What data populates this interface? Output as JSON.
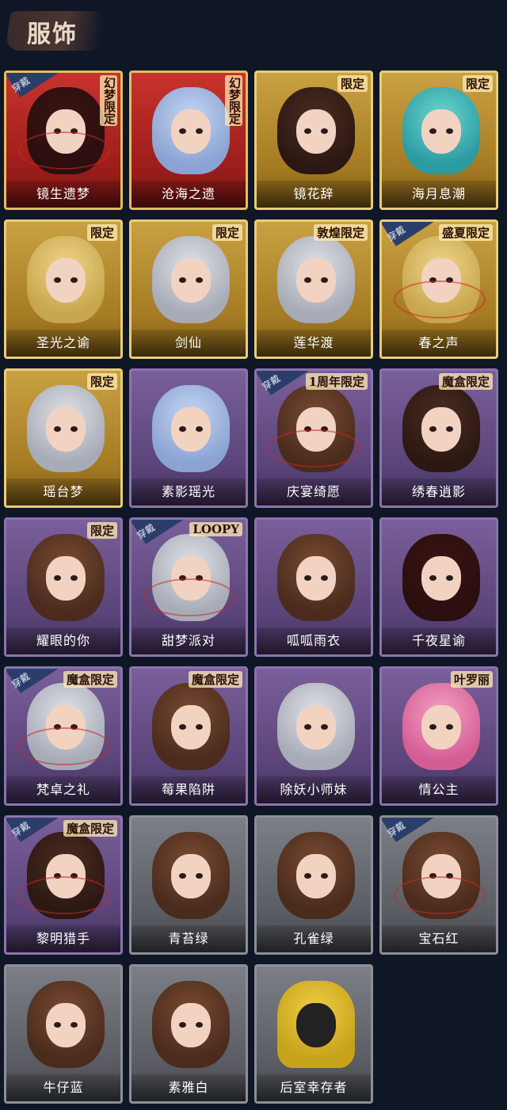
{
  "header": {
    "title": "服饰"
  },
  "colors": {
    "background": "#0f1726"
  },
  "cards": [
    {
      "name": "镜生遗梦",
      "rarity": "red",
      "tag": "幻梦限定",
      "tag_vertical": true,
      "wearing": true,
      "wear_label": "穿戴",
      "hair": "red"
    },
    {
      "name": "沧海之遗",
      "rarity": "red",
      "tag": "幻梦限定",
      "tag_vertical": true,
      "wearing": false,
      "wear_label": "",
      "hair": "blue"
    },
    {
      "name": "镜花辞",
      "rarity": "gold",
      "tag": "限定",
      "tag_vertical": false,
      "wearing": false,
      "wear_label": "",
      "hair": "dark"
    },
    {
      "name": "海月息潮",
      "rarity": "gold",
      "tag": "限定",
      "tag_vertical": false,
      "wearing": false,
      "wear_label": "",
      "hair": "teal"
    },
    {
      "name": "圣光之谕",
      "rarity": "gold",
      "tag": "限定",
      "tag_vertical": false,
      "wearing": false,
      "wear_label": "",
      "hair": "blond"
    },
    {
      "name": "剑仙",
      "rarity": "gold",
      "tag": "限定",
      "tag_vertical": false,
      "wearing": false,
      "wear_label": "",
      "hair": "silver"
    },
    {
      "name": "莲华渡",
      "rarity": "gold",
      "tag": "敦煌限定",
      "tag_vertical": false,
      "wearing": false,
      "wear_label": "",
      "hair": "silver"
    },
    {
      "name": "春之声",
      "rarity": "gold",
      "tag": "盛夏限定",
      "tag_vertical": false,
      "wearing": true,
      "wear_label": "穿戴",
      "hair": "blond"
    },
    {
      "name": "瑶台梦",
      "rarity": "gold",
      "tag": "限定",
      "tag_vertical": false,
      "wearing": false,
      "wear_label": "",
      "hair": "silver"
    },
    {
      "name": "素影瑶光",
      "rarity": "purple",
      "tag": "",
      "tag_vertical": false,
      "wearing": false,
      "wear_label": "",
      "hair": "blue"
    },
    {
      "name": "庆宴绮愿",
      "rarity": "purple",
      "tag": "1周年限定",
      "tag_vertical": false,
      "wearing": true,
      "wear_label": "穿戴",
      "hair": "brown"
    },
    {
      "name": "绣春逍影",
      "rarity": "purple",
      "tag": "魔盒限定",
      "tag_vertical": false,
      "wearing": false,
      "wear_label": "",
      "hair": "dark"
    },
    {
      "name": "耀眼的你",
      "rarity": "purple",
      "tag": "限定",
      "tag_vertical": false,
      "wearing": false,
      "wear_label": "",
      "hair": "brown"
    },
    {
      "name": "甜梦派对",
      "rarity": "purple",
      "tag": "LOOPY",
      "tag_vertical": false,
      "wearing": true,
      "wear_label": "穿戴",
      "hair": "silver"
    },
    {
      "name": "呱呱雨衣",
      "rarity": "purple",
      "tag": "",
      "tag_vertical": false,
      "wearing": false,
      "wear_label": "",
      "hair": "brown"
    },
    {
      "name": "千夜星谕",
      "rarity": "purple",
      "tag": "",
      "tag_vertical": false,
      "wearing": false,
      "wear_label": "",
      "hair": "red"
    },
    {
      "name": "梵卓之礼",
      "rarity": "purple",
      "tag": "魔盒限定",
      "tag_vertical": false,
      "wearing": true,
      "wear_label": "穿戴",
      "hair": "silver"
    },
    {
      "name": "莓果陷阱",
      "rarity": "purple",
      "tag": "魔盒限定",
      "tag_vertical": false,
      "wearing": false,
      "wear_label": "",
      "hair": "brown"
    },
    {
      "name": "除妖小师妹",
      "rarity": "purple",
      "tag": "",
      "tag_vertical": false,
      "wearing": false,
      "wear_label": "",
      "hair": "silver"
    },
    {
      "name": "情公主",
      "rarity": "purple",
      "tag": "叶罗丽",
      "tag_vertical": false,
      "wearing": false,
      "wear_label": "",
      "hair": "pink"
    },
    {
      "name": "黎明猎手",
      "rarity": "purple",
      "tag": "魔盒限定",
      "tag_vertical": false,
      "wearing": true,
      "wear_label": "穿戴",
      "hair": "dark"
    },
    {
      "name": "青苔绿",
      "rarity": "gray",
      "tag": "",
      "tag_vertical": false,
      "wearing": false,
      "wear_label": "",
      "hair": "brown"
    },
    {
      "name": "孔雀绿",
      "rarity": "gray",
      "tag": "",
      "tag_vertical": false,
      "wearing": false,
      "wear_label": "",
      "hair": "brown"
    },
    {
      "name": "宝石红",
      "rarity": "gray",
      "tag": "",
      "tag_vertical": false,
      "wearing": true,
      "wear_label": "穿戴",
      "hair": "brown"
    },
    {
      "name": "牛仔蓝",
      "rarity": "gray",
      "tag": "",
      "tag_vertical": false,
      "wearing": false,
      "wear_label": "",
      "hair": "brown"
    },
    {
      "name": "素雅白",
      "rarity": "gray",
      "tag": "",
      "tag_vertical": false,
      "wearing": false,
      "wear_label": "",
      "hair": "brown"
    },
    {
      "name": "后室幸存者",
      "rarity": "gray",
      "tag": "",
      "tag_vertical": false,
      "wearing": false,
      "wear_label": "",
      "hair": "yellow"
    }
  ]
}
